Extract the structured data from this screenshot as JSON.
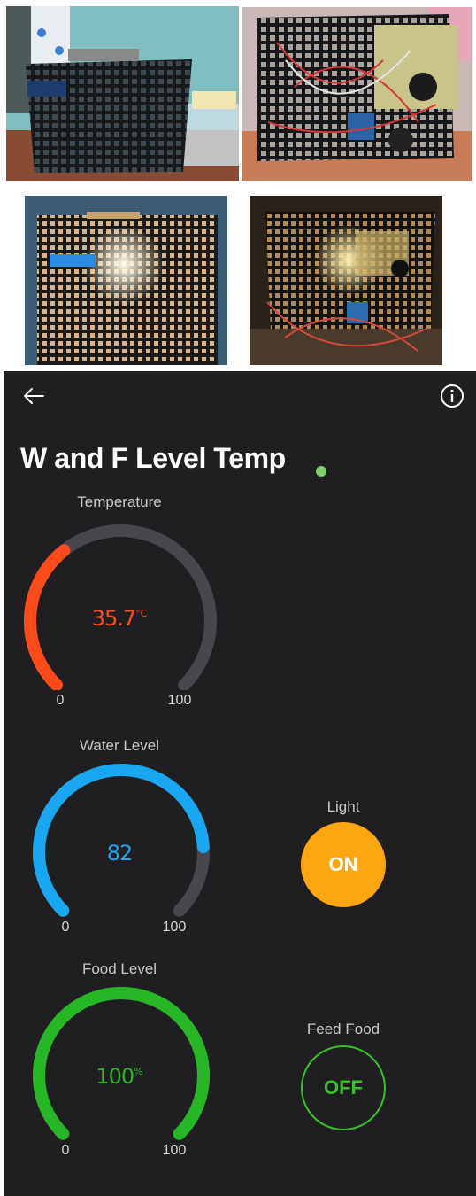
{
  "photos": [
    {
      "alt": "photo-1"
    },
    {
      "alt": "photo-2"
    },
    {
      "alt": "photo-3"
    },
    {
      "alt": "photo-4"
    }
  ],
  "dashboard": {
    "title": "W and F Level Temp",
    "status_color": "#7ed06a",
    "back_icon": "arrow-left-icon",
    "info_icon": "info-circle-icon",
    "gauges": {
      "temperature": {
        "label": "Temperature",
        "value": "35.7",
        "unit": "°C",
        "min": "0",
        "max": "100",
        "level": 35.7,
        "color": "#ff4a1c"
      },
      "water": {
        "label": "Water Level",
        "value": "82",
        "unit": "",
        "min": "0",
        "max": "100",
        "level": 82,
        "color": "#19a7f2"
      },
      "food": {
        "label": "Food Level",
        "value": "100",
        "unit": "%",
        "min": "0",
        "max": "100",
        "level": 100,
        "color": "#27b626"
      }
    },
    "buttons": {
      "light": {
        "label": "Light",
        "state": "ON",
        "color": "#fca611"
      },
      "feed": {
        "label": "Feed Food",
        "state": "OFF",
        "color": "#37c22a"
      }
    },
    "track_color": "#48484c"
  }
}
